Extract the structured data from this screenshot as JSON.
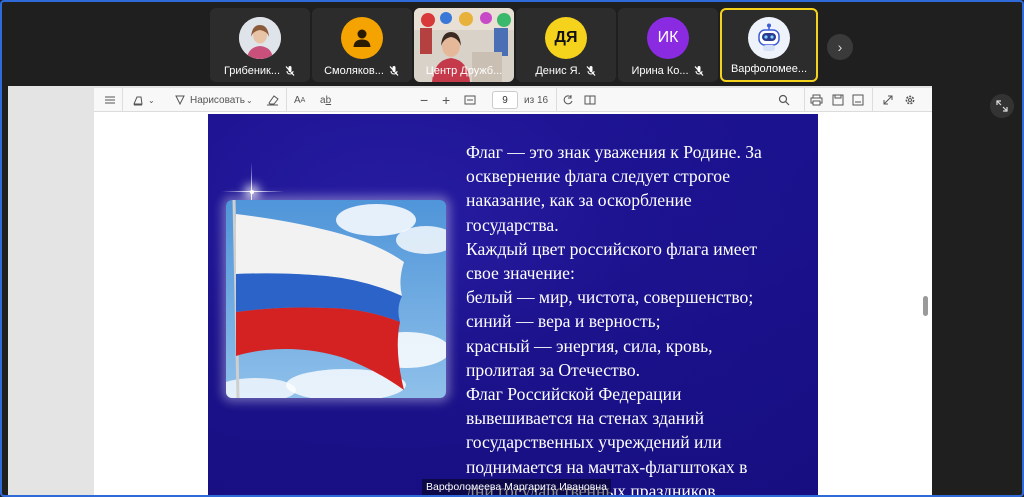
{
  "participants": [
    {
      "name": "Грибеник...",
      "avatar_type": "photo",
      "mic": "mic-off-icon"
    },
    {
      "name": "Смоляков...",
      "avatar_type": "user-icon",
      "avatar_color": "#f5a300",
      "mic": "mic-off-icon"
    },
    {
      "name": "Центр Дружб...",
      "avatar_type": "video",
      "mic": ""
    },
    {
      "name": "Денис Я.",
      "initials": "ДЯ",
      "avatar_color": "#f5d21b",
      "mic": "mic-off-icon"
    },
    {
      "name": "Ирина Ко...",
      "initials": "ИК",
      "avatar_color": "#8a2be2",
      "mic": "mic-off-icon"
    },
    {
      "name": "Варфоломее...",
      "avatar_type": "robot-icon",
      "active": true,
      "active_color": "#f5d21b"
    }
  ],
  "toolbar": {
    "draw_label": "Нарисовать",
    "page_current": "9",
    "page_total_label": "из 16"
  },
  "slide": {
    "lines": [
      "Флаг — это знак уважения к Родине. За",
      "осквернение флага следует строгое",
      "наказание, как за оскорбление",
      "государства.",
      "Каждый цвет российского флага имеет",
      "свое значение:",
      "белый — мир, чистота, совершенство;",
      "синий — вера и верность;",
      "красный — энергия, сила, кровь,",
      "пролитая за Отечество.",
      "Флаг Российской Федерации",
      "вывешивается на стенах зданий",
      "государственных учреждений или",
      "поднимается на мачтах-флагштоках в",
      "дни государственных праздников"
    ]
  },
  "speaker_caption": "Варфоломеева Маргарита Ивановна",
  "colors": {
    "accent": "#2f6ad9",
    "active_border": "#f5d21b",
    "slide_bg": "#1e1494"
  }
}
